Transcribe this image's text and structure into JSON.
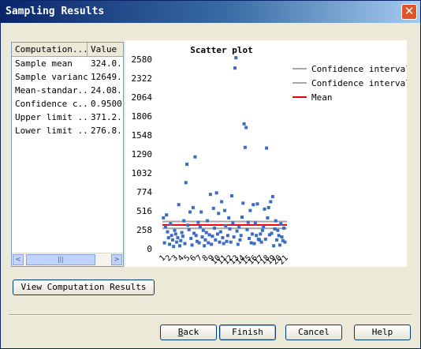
{
  "window": {
    "title": "Sampling Results",
    "close_glyph": "✕"
  },
  "grid": {
    "headers": [
      "Computation...",
      "Value"
    ],
    "rows": [
      [
        "Sample mean",
        "324.0."
      ],
      [
        "Sample variance",
        "12649."
      ],
      [
        "Mean-standar...",
        "24.08."
      ],
      [
        "Confidence c...",
        "0.9500"
      ],
      [
        "Upper limit ...",
        "371.2."
      ],
      [
        "Lower limit ...",
        "276.8."
      ]
    ],
    "scroll": {
      "left_arrow": "<",
      "right_arrow": ">",
      "thumb_grip": "|||"
    }
  },
  "chart_data": {
    "type": "scatter",
    "title": "Scatter plot",
    "yticks": [
      0,
      258,
      516,
      774,
      1032,
      1290,
      1548,
      1806,
      2064,
      2322,
      2580
    ],
    "ylim": [
      0,
      2580
    ],
    "xlim": [
      0,
      122
    ],
    "xtick_labels": [
      "1",
      "2",
      "3",
      "4",
      "5",
      "6",
      "7",
      "8",
      "9",
      "10",
      "11",
      "12",
      "13",
      "14",
      "15",
      "16",
      "17",
      "18",
      "19",
      "20",
      "21"
    ],
    "legend_position": "top-right",
    "legend": [
      {
        "name": "Confidence interval",
        "color": "#a6a6a6"
      },
      {
        "name": "Confidence interval",
        "color": "#a6a6a6"
      },
      {
        "name": "Mean",
        "color": "#e0000d"
      }
    ],
    "lines": {
      "upper": 371.2,
      "lower": 276.8,
      "mean": 324.0
    },
    "point_color": "#3a6cc4",
    "x": [
      1,
      2,
      3,
      4,
      5,
      6,
      7,
      8,
      9,
      10,
      11,
      12,
      13,
      14,
      15,
      16,
      17,
      18,
      19,
      20,
      21,
      22,
      23,
      24,
      25,
      26,
      27,
      28,
      29,
      30,
      31,
      32,
      33,
      34,
      35,
      36,
      37,
      38,
      39,
      40,
      41,
      42,
      43,
      44,
      45,
      46,
      47,
      48,
      49,
      50,
      51,
      52,
      53,
      54,
      55,
      56,
      57,
      58,
      59,
      60,
      61,
      62,
      63,
      64,
      65,
      66,
      67,
      68,
      69,
      70,
      71,
      72,
      73,
      74,
      75,
      76,
      77,
      78,
      79,
      80,
      81,
      82,
      83,
      84,
      85,
      86,
      87,
      88,
      89,
      90,
      91,
      92,
      93,
      94,
      95,
      96,
      97,
      98,
      99,
      100,
      101,
      102,
      103,
      104,
      105,
      106,
      107,
      108,
      109,
      110,
      111,
      112,
      113,
      114,
      115,
      116,
      117,
      118,
      119,
      120
    ],
    "y": [
      420,
      80,
      300,
      460,
      230,
      150,
      60,
      340,
      180,
      120,
      30,
      250,
      200,
      90,
      150,
      600,
      40,
      110,
      220,
      170,
      380,
      70,
      900,
      1150,
      320,
      260,
      500,
      140,
      50,
      560,
      210,
      1250,
      180,
      100,
      360,
      80,
      300,
      500,
      160,
      250,
      40,
      120,
      220,
      380,
      80,
      190,
      740,
      60,
      170,
      550,
      280,
      120,
      760,
      200,
      480,
      90,
      230,
      640,
      150,
      70,
      520,
      310,
      100,
      180,
      420,
      270,
      90,
      720,
      350,
      160,
      2460,
      2600,
      240,
      60,
      300,
      120,
      180,
      430,
      620,
      1700,
      1380,
      1650,
      260,
      360,
      140,
      520,
      80,
      200,
      600,
      70,
      350,
      180,
      610,
      130,
      120,
      200,
      90,
      250,
      300,
      540,
      130,
      1370,
      420,
      560,
      190,
      640,
      210,
      710,
      40,
      270,
      380,
      120,
      250,
      180,
      50,
      340,
      160,
      110,
      280,
      90
    ]
  },
  "buttons": {
    "view": "View Computation Results",
    "back_mnemonic": "B",
    "back_rest": "ack",
    "finish": "Finish",
    "cancel": "Cancel",
    "help": "Help"
  }
}
